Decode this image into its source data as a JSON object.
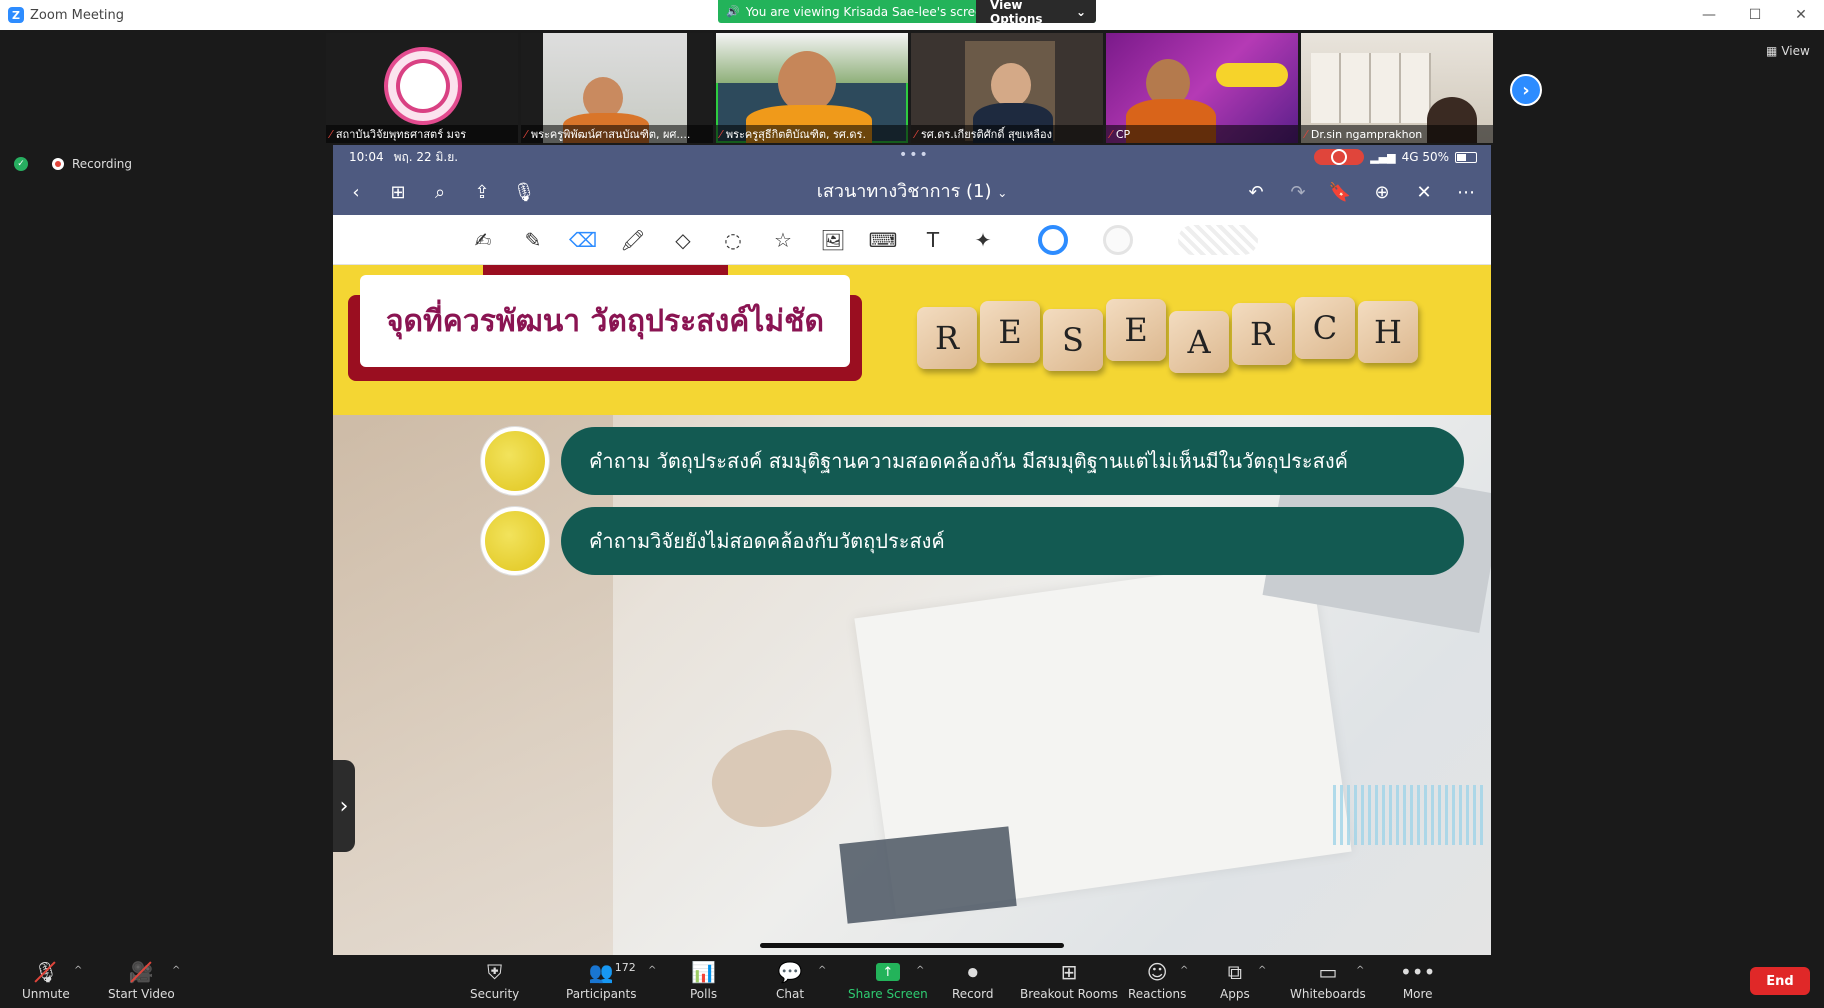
{
  "window": {
    "title": "Zoom Meeting",
    "controls": [
      "—",
      "☐",
      "✕"
    ]
  },
  "banner": {
    "viewing_text": "You are viewing Krisada Sae-lee's screen",
    "view_options_label": "View Options",
    "view_options_caret": "⌄"
  },
  "participants_strip": [
    {
      "name": "สถาบันวิจัยพุทธศาสตร์ มจร"
    },
    {
      "name": "พระครูพิพัฒน์ศาสนบัณฑิต, ผศ...."
    },
    {
      "name": "พระครูสุธีกิตติบัณฑิต, รศ.ดร."
    },
    {
      "name": "รศ.ดร.เกียรติศักดิ์ สุขเหลือง"
    },
    {
      "name": "CP"
    },
    {
      "name": "Dr.sin ngamprakhon"
    }
  ],
  "view_button_label": "View",
  "recording_label": "Recording",
  "ipad_status": {
    "time": "10:04",
    "date": "พฤ. 22 มิ.ย.",
    "network": "4G 50%"
  },
  "notes_app": {
    "doc_title": "เสวนาทางวิชาการ (1)",
    "doc_title_caret": "⌄"
  },
  "slide": {
    "title": "จุดที่ควรพัฒนา วัตถุประสงค์ไม่ชัด",
    "dice_letters": [
      "R",
      "E",
      "S",
      "E",
      "A",
      "R",
      "C",
      "H"
    ],
    "bullets": [
      "คำถาม วัตถุประสงค์ สมมุติฐานความสอดคล้องกัน มีสมมุติฐานแต่ไม่เห็นมีในวัตถุประสงค์",
      "คำถามวิจัยยังไม่สอดคล้องกับวัตถุประสงค์"
    ]
  },
  "toolbar": {
    "unmute": "Unmute",
    "start_video": "Start Video",
    "security": "Security",
    "participants": "Participants",
    "participants_count": "172",
    "polls": "Polls",
    "chat": "Chat",
    "share_screen": "Share Screen",
    "record": "Record",
    "breakout_rooms": "Breakout Rooms",
    "reactions": "Reactions",
    "apps": "Apps",
    "whiteboards": "Whiteboards",
    "more": "More",
    "end": "End"
  },
  "colors": {
    "zoom_blue": "#2d8cff",
    "banner_green": "#23b35a",
    "ipad_toolbar": "#4e5a80",
    "slide_yellow": "#f4d633",
    "slide_maroon": "#9a0e20",
    "bullet_teal": "#135a52",
    "end_red": "#e02828"
  }
}
